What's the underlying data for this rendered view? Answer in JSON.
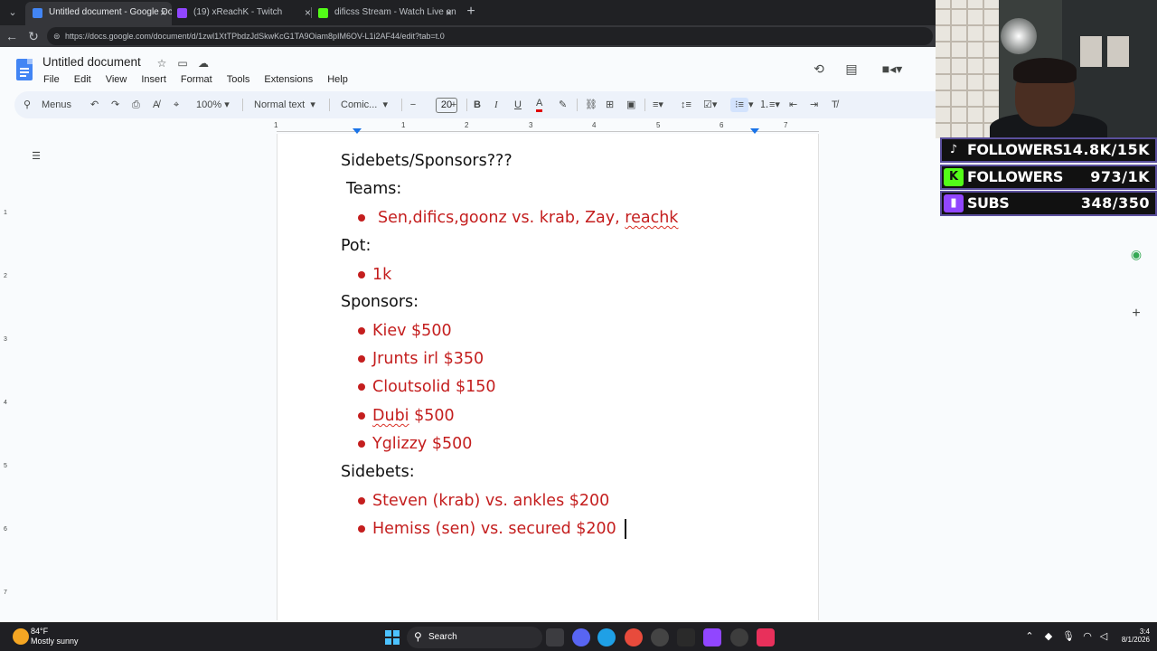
{
  "browser": {
    "tabs": [
      {
        "title": "Untitled document - Google Docs",
        "active": true,
        "favicon_color": "#4285f4"
      },
      {
        "title": "(19) xReachK - Twitch",
        "active": false,
        "favicon_color": "#9146ff"
      },
      {
        "title": "dificss Stream - Watch Live on Kick",
        "active": false,
        "favicon_color": "#53fc18"
      }
    ],
    "url": "https://docs.google.com/document/d/1zwl1XtTPbdzJdSkwKcG1TA9Oiam8pIM6OV-L1i2AF44/edit?tab=t.0"
  },
  "docs": {
    "title": "Untitled document",
    "menu": [
      "File",
      "Edit",
      "View",
      "Insert",
      "Format",
      "Tools",
      "Extensions",
      "Help"
    ],
    "toolbar": {
      "search_menus": "Menus",
      "zoom": "100%",
      "style": "Normal text",
      "font": "Comic...",
      "font_size": "20",
      "minus": "−",
      "plus": "+"
    },
    "ruler_numbers": [
      "1",
      "1",
      "2",
      "3",
      "4",
      "5",
      "6",
      "7"
    ],
    "vruler_numbers": [
      "1",
      "2",
      "3",
      "4",
      "5",
      "6",
      "7"
    ]
  },
  "document": {
    "heading": "Sidebets/Sponsors???",
    "teams_label": "Teams:",
    "teams_text": "Sen,difics,goonz vs. krab, Zay,",
    "teams_text_misspelled": "reachk",
    "pot_label": "Pot:",
    "pot_value": "1k",
    "sponsors_label": "Sponsors:",
    "sponsors": [
      {
        "name": "Kiev",
        "amount": "$500",
        "misspelled": false
      },
      {
        "name": "Jrunts irl",
        "amount": "$350",
        "misspelled": false
      },
      {
        "name": "Cloutsolid",
        "amount": "$150",
        "misspelled": false
      },
      {
        "name": "Dubi",
        "amount": "$500",
        "misspelled": true
      },
      {
        "name": "Yglizzy",
        "amount": "$500",
        "misspelled": false
      }
    ],
    "sidebets_label": "Sidebets:",
    "sidebets": [
      "Steven (krab) vs. ankles $200",
      "Hemiss (sen) vs. secured $200"
    ],
    "text_color": "#c41e1e"
  },
  "overlay": {
    "stats": [
      {
        "label": "FOLLOWERS",
        "value": "14.8K/15K",
        "platform": "tiktok",
        "icon_color": "#111111"
      },
      {
        "label": "FOLLOWERS",
        "value": "973/1K",
        "platform": "kick",
        "icon_color": "#53fc18"
      },
      {
        "label": "SUBS",
        "value": "348/350",
        "platform": "twitch",
        "icon_color": "#9146ff"
      }
    ]
  },
  "taskbar": {
    "weather_temp": "84°F",
    "weather_desc": "Mostly sunny",
    "search_placeholder": "Search",
    "clock_time": "3:4",
    "clock_date": "8/1/2026"
  }
}
